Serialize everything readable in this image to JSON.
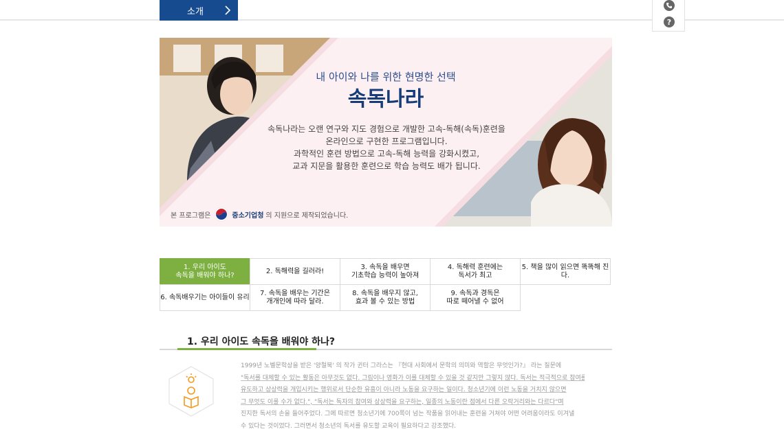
{
  "nav": {
    "tab_label": "소개"
  },
  "quick_menu": {
    "items": [
      "phone-icon",
      "help-icon"
    ],
    "help_glyph": "?"
  },
  "hero": {
    "subtitle": "내 아이와 나를 위한 현명한 선택",
    "title": "속독나라",
    "description": [
      "속독나라는 오랜 연구와 지도 경험으로 개발한 고속-독해(속독)훈련을",
      "온라인으로 구현한 프로그램입니다.",
      "과학적인 훈련 방법으로 고속-독해 능력을 강화시켰고,",
      "교과 지문을 활용한 훈련으로 학습 능력도 배가 됩니다."
    ],
    "support_prefix": "본 프로그램은",
    "support_org": "중소기업청",
    "support_suffix": "의 지원으로 제작되었습니다."
  },
  "tabs": [
    "1. 우리 아이도\n속독을 배워야 하나?",
    "2. 독해력을 길러라!",
    "3. 속독을 배우면\n기초학습 능력이 높아져",
    "4. 독해력 훈련에는\n독서가 최고",
    "5. 책을 많이 읽으면 똑똑해 진다.",
    "6. 속독배우기는 아이들이 유리",
    "7. 속독을 배우는 기간은\n개개인에 따라 달라.",
    "8. 속독을 배우지 않고,\n효과 볼 수 있는 방법",
    "9. 속독과 경독은\n따로 떼어낼 수 없어"
  ],
  "active_tab_index": 0,
  "section": {
    "title": "1. 우리 아이도 속독을 배워야 하나?",
    "paragraph": [
      "1999년 노벨문학상을 받은 '양철북' 의 작가 귄터 그라스는 『현대 사회에서 문학의 의미와 역할은 무엇인가?』 라는 질문에",
      "\"독서를 대체할 수 있는 활동은 아무것도 없다. 그림이나 영화가 이를 대체할 수 있을 것 같지만 그렇지 않다. 독서는 적극적으로 참여를",
      "유도하고 상상력을 개입시키는 행위로서 단순한 유흥이 아니라 노동을 요구하는 일이다. 청소년기에 이런 노동을 거치지 않으면",
      "그 무엇도 이룰 수가 없다.\", \"독서는 독자의 참여와 상상력을 요구하는, 일종의 노동이란 점에서 다른 오락거리와는 다르다\"며",
      "진지한 독서의 손을 들어주었다. 그에 따르면 청소년기에 700쪽이 넘는 작품을 읽어내는 훈련을 거쳐야 어떤 어려움이라도 이겨낼",
      "수 있다는 것이었다. 그러면서 청소년의 독서를 유도할 교육이 필요하다고 강조했다."
    ]
  },
  "colors": {
    "nav_blue": "#174b8f",
    "title_blue": "#163d7a",
    "accent_green": "#7db040",
    "hero_pink": "#fdf0f2",
    "icon_orange": "#f29b1d"
  }
}
